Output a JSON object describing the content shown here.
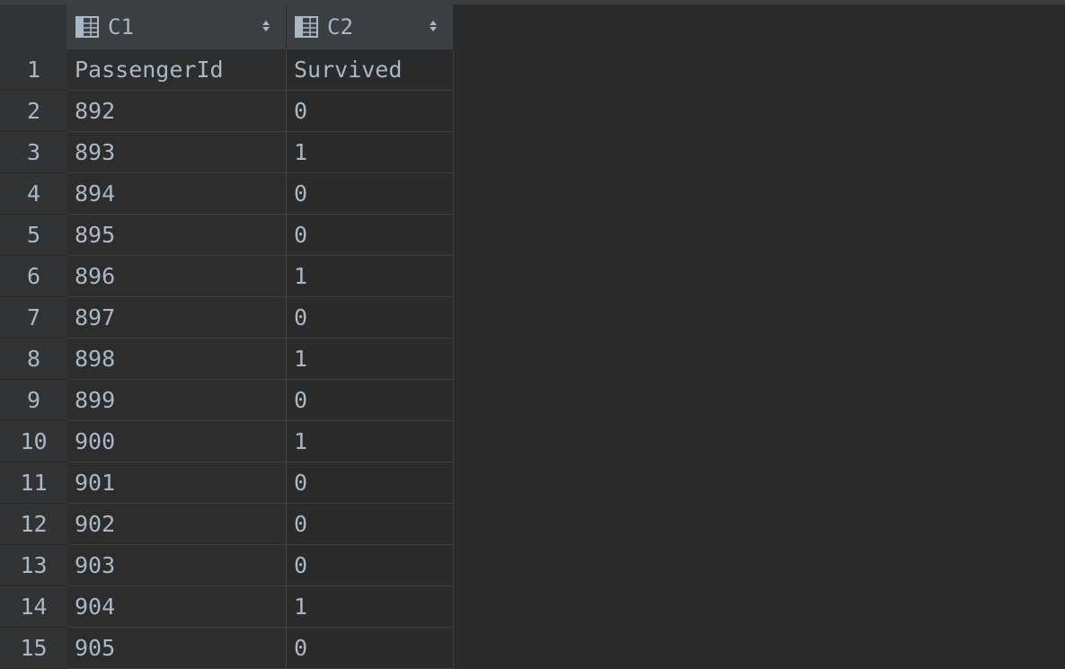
{
  "columns": [
    {
      "label": "C1"
    },
    {
      "label": "C2"
    }
  ],
  "rows": [
    {
      "num": "1",
      "c1": "PassengerId",
      "c2": "Survived"
    },
    {
      "num": "2",
      "c1": "892",
      "c2": "0"
    },
    {
      "num": "3",
      "c1": "893",
      "c2": "1"
    },
    {
      "num": "4",
      "c1": "894",
      "c2": "0"
    },
    {
      "num": "5",
      "c1": "895",
      "c2": "0"
    },
    {
      "num": "6",
      "c1": "896",
      "c2": "1"
    },
    {
      "num": "7",
      "c1": "897",
      "c2": "0"
    },
    {
      "num": "8",
      "c1": "898",
      "c2": "1"
    },
    {
      "num": "9",
      "c1": "899",
      "c2": "0"
    },
    {
      "num": "10",
      "c1": "900",
      "c2": "1"
    },
    {
      "num": "11",
      "c1": "901",
      "c2": "0"
    },
    {
      "num": "12",
      "c1": "902",
      "c2": "0"
    },
    {
      "num": "13",
      "c1": "903",
      "c2": "0"
    },
    {
      "num": "14",
      "c1": "904",
      "c2": "1"
    },
    {
      "num": "15",
      "c1": "905",
      "c2": "0"
    }
  ],
  "colors": {
    "background": "#2b2b2b",
    "header": "#3c3f41",
    "text": "#a9b7c6"
  },
  "icons": {
    "column_type": "table-icon",
    "sort": "sort-arrows-icon"
  }
}
